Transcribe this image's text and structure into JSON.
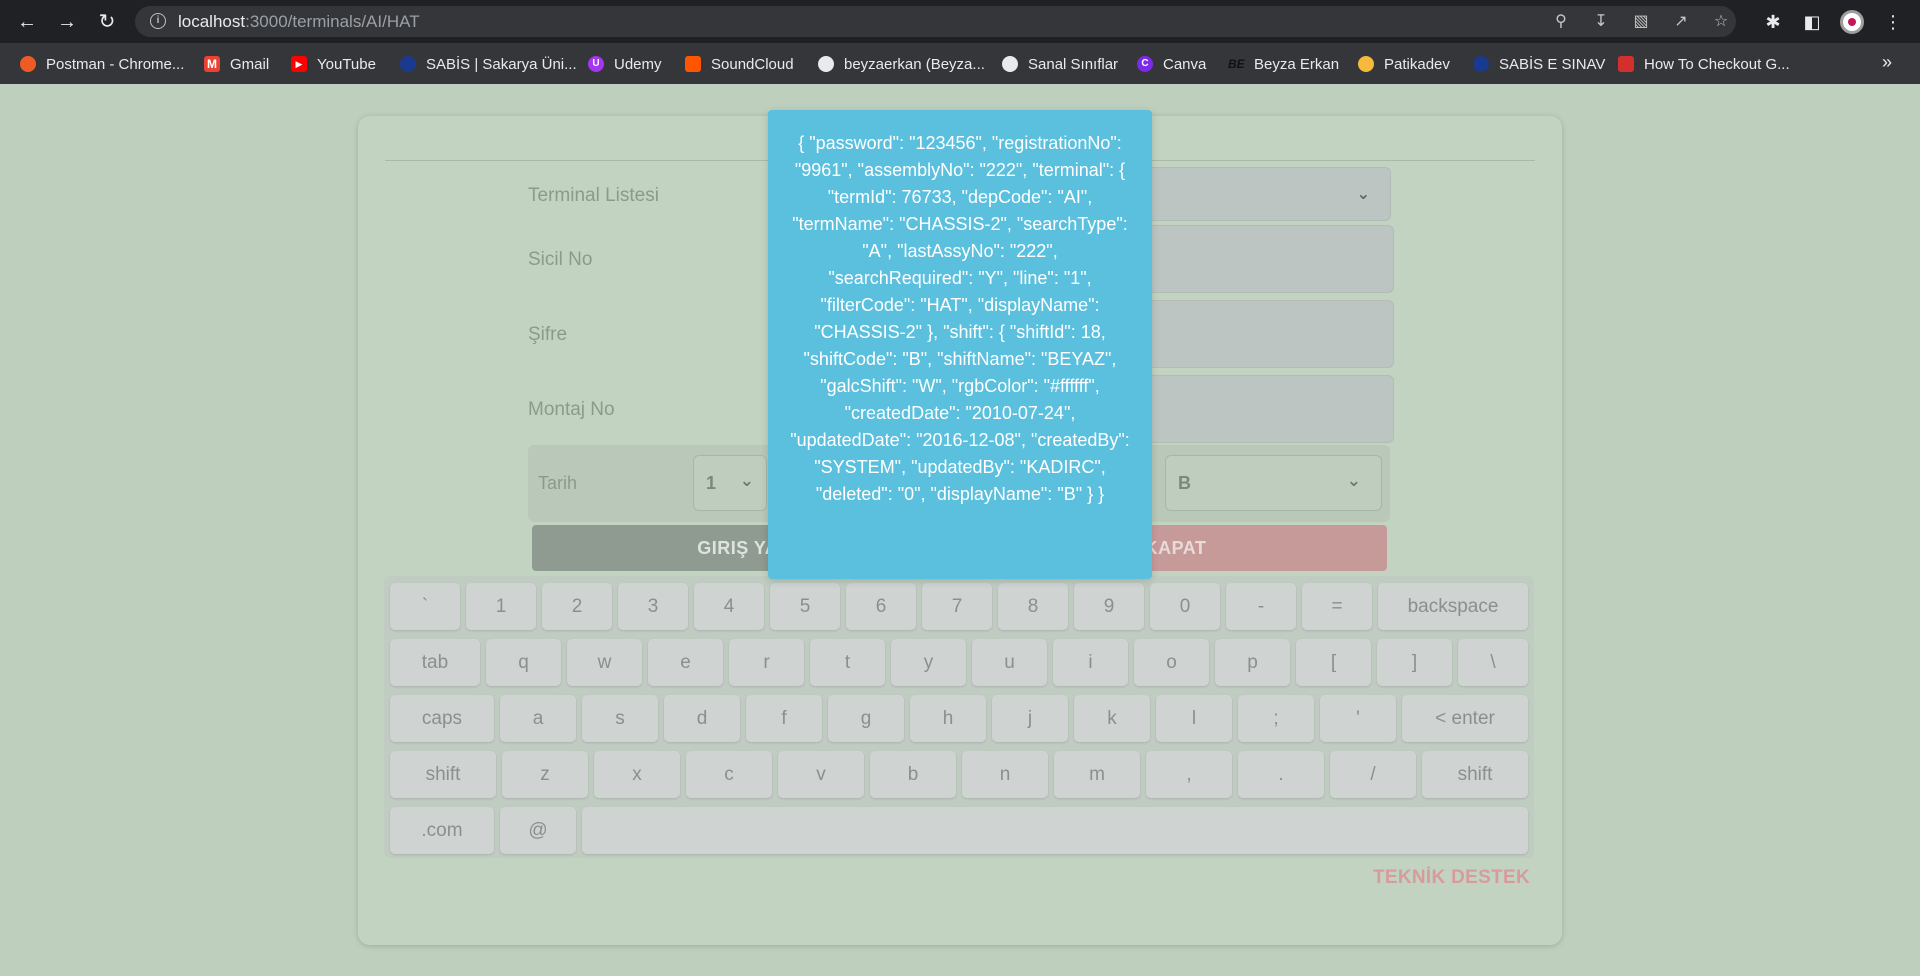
{
  "browser": {
    "url_host": "localhost",
    "url_path": ":3000/terminals/AI/HAT",
    "bookmarks": [
      {
        "label": "Postman - Chrome...",
        "icon": "postman-icon",
        "color": "#ef5b25"
      },
      {
        "label": "Gmail",
        "icon": "gmail-icon",
        "color": "#ea4335"
      },
      {
        "label": "YouTube",
        "icon": "youtube-icon",
        "color": "#ff0000"
      },
      {
        "label": "SABİS | Sakarya Üni...",
        "icon": "sabis-icon",
        "color": "#1a3a8f"
      },
      {
        "label": "Udemy",
        "icon": "udemy-icon",
        "color": "#a435f0"
      },
      {
        "label": "SoundCloud",
        "icon": "soundcloud-icon",
        "color": "#ff5500"
      },
      {
        "label": "beyzaerkan (Beyza...",
        "icon": "github-icon",
        "color": "#e8eaed"
      },
      {
        "label": "Sanal Sınıflar",
        "icon": "globe-icon",
        "color": "#e8eaed"
      },
      {
        "label": "Canva",
        "icon": "canva-icon",
        "color": "#7d2ae8"
      },
      {
        "label": "Beyza Erkan",
        "icon": "signature-icon",
        "color": "#202124"
      },
      {
        "label": "Patikadev",
        "icon": "patikadev-icon",
        "color": "#f6b93b"
      },
      {
        "label": "SABİS E SINAV",
        "icon": "sabis-icon",
        "color": "#1a3a8f"
      },
      {
        "label": "How To Checkout G...",
        "icon": "cube-icon",
        "color": "#d32f2f"
      }
    ]
  },
  "form": {
    "terminal_label": "Terminal Listesi",
    "sicil_label": "Sicil No",
    "sifre_label": "Şifre",
    "montaj_label": "Montaj No",
    "tarih_label": "Tarih",
    "line_value": "1",
    "shift_value": "B",
    "login_button": "GIRIŞ YAP",
    "close_button": "KAPAT",
    "support_link": "TEKNİK DESTEK"
  },
  "keyboard": {
    "rows": [
      [
        "`",
        "1",
        "2",
        "3",
        "4",
        "5",
        "6",
        "7",
        "8",
        "9",
        "0",
        "-",
        "=",
        "backspace"
      ],
      [
        "tab",
        "q",
        "w",
        "e",
        "r",
        "t",
        "y",
        "u",
        "i",
        "o",
        "p",
        "[",
        "]",
        "\\"
      ],
      [
        "caps",
        "a",
        "s",
        "d",
        "f",
        "g",
        "h",
        "j",
        "k",
        "l",
        ";",
        "'",
        "< enter"
      ],
      [
        "shift",
        "z",
        "x",
        "c",
        "v",
        "b",
        "n",
        "m",
        ",",
        ".",
        "/",
        "shift"
      ],
      [
        ".com",
        "@",
        ""
      ]
    ]
  },
  "popup": {
    "text": "{ \"password\": \"123456\", \"registrationNo\": \"9961\", \"assemblyNo\": \"222\", \"terminal\": { \"termId\": 76733, \"depCode\": \"AI\", \"termName\": \"CHASSIS-2\", \"searchType\": \"A\", \"lastAssyNo\": \"222\", \"searchRequired\": \"Y\", \"line\": \"1\", \"filterCode\": \"HAT\", \"displayName\": \"CHASSIS-2\" }, \"shift\": { \"shiftId\": 18, \"shiftCode\": \"B\", \"shiftName\": \"BEYAZ\", \"galcShift\": \"W\", \"rgbColor\": \"#ffffff\", \"createdDate\": \"2010-07-24\", \"updatedDate\": \"2016-12-08\", \"createdBy\": \"SYSTEM\", \"updatedBy\": \"KADIRC\", \"deleted\": \"0\", \"displayName\": \"B\" } }",
    "background": "#5bc0de"
  }
}
